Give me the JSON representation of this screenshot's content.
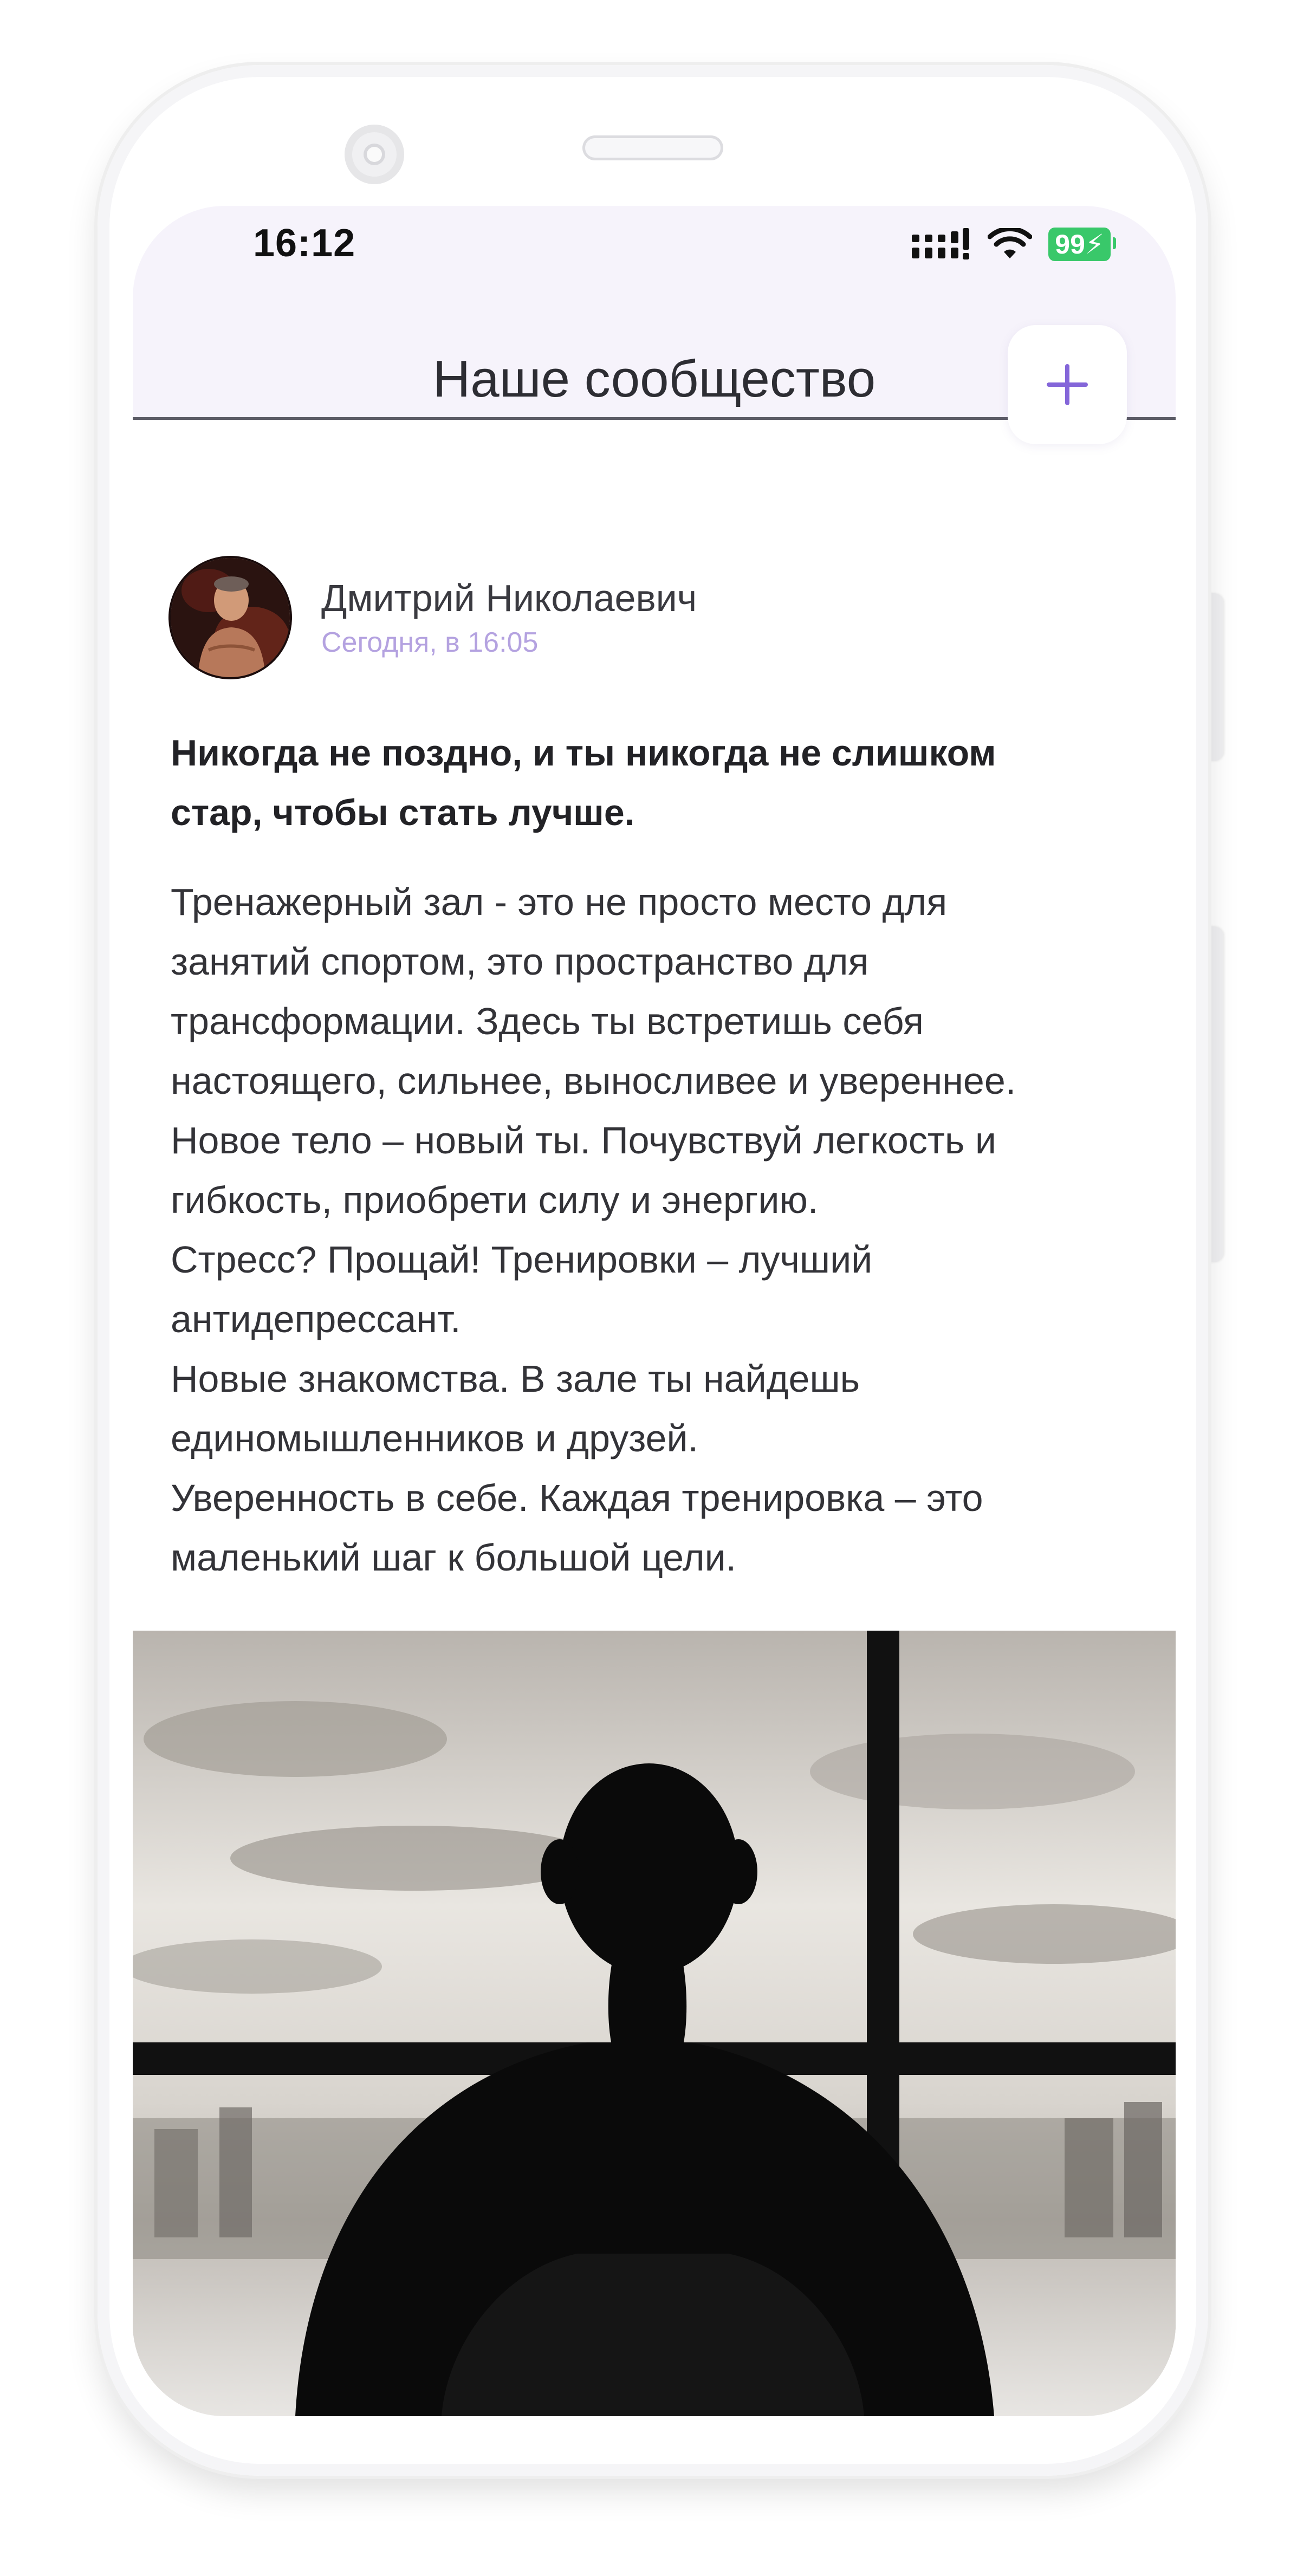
{
  "status_bar": {
    "time": "16:12",
    "battery": "99"
  },
  "header": {
    "title": "Наше сообщество",
    "add_label": "+"
  },
  "post": {
    "author": "Дмитрий Николаевич",
    "date": "Сегодня, в 16:05",
    "title_lines": [
      "Никогда не поздно, и ты никогда не слишком",
      "стар, чтобы стать лучше."
    ],
    "body_lines": [
      "Тренажерный зал - это не просто место для",
      "занятий спортом, это пространство для",
      "трансформации. Здесь ты встретишь себя",
      "настоящего, сильнее, выносливее и увереннее.",
      "Новое тело – новый ты. Почувствуй легкость и",
      "гибкость, приобрети силу и энергию.",
      "Стресс? Прощай! Тренировки – лучший",
      "антидепрессант.",
      "Новые знакомства. В зале ты найдешь",
      "единомышленников и друзей.",
      "Уверенность в себе. Каждая тренировка – это",
      "маленький шаг к большой цели."
    ]
  },
  "icons": {
    "signal": "cellular-signal-icon",
    "wifi": "wifi-icon",
    "battery": "battery-icon",
    "add": "plus-icon"
  },
  "colors": {
    "accent": "#8466d9",
    "header_bg": "#f6f3fb",
    "date_text": "#b4a2e0",
    "battery_green": "#39c86a"
  }
}
